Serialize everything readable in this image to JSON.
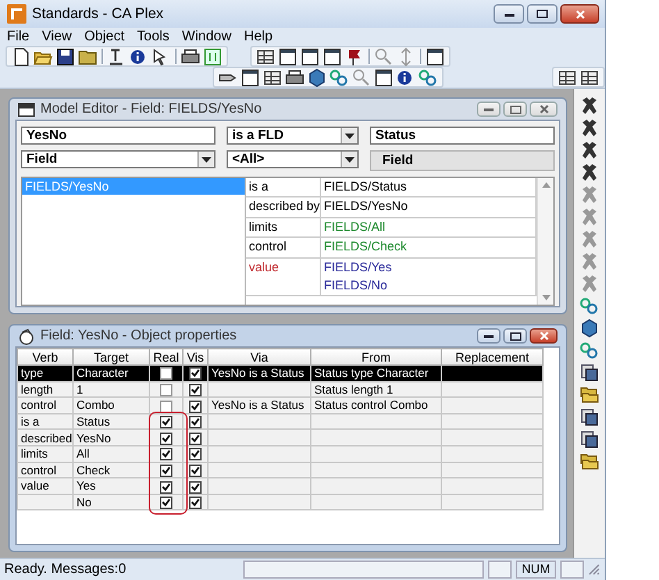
{
  "window": {
    "title": "Standards - CA Plex"
  },
  "menu": [
    "File",
    "View",
    "Object",
    "Tools",
    "Window",
    "Help"
  ],
  "model_editor": {
    "title": "Model Editor - Field: FIELDS/YesNo",
    "filters": [
      {
        "kind": "text",
        "value": "YesNo"
      },
      {
        "kind": "dropdown",
        "value": "is a FLD"
      },
      {
        "kind": "text",
        "value": "Status"
      },
      {
        "kind": "dropdown",
        "value": "Field"
      },
      {
        "kind": "dropdown",
        "value": "<All>"
      },
      {
        "kind": "label",
        "value": "Field"
      }
    ],
    "objects": [
      {
        "text": "FIELDS/YesNo",
        "selected": true
      }
    ],
    "relations": [
      {
        "verb": {
          "text": "is a",
          "color": "#000000"
        },
        "target": "FIELDS/Status",
        "color": "#000000"
      },
      {
        "verb": {
          "text": "described by",
          "color": "#000000"
        },
        "target": "FIELDS/YesNo",
        "color": "#000000"
      },
      {
        "verb": {
          "text": "limits",
          "color": "#000000"
        },
        "target": "FIELDS/All",
        "color": "#1e8a2e"
      },
      {
        "verb": {
          "text": "control",
          "color": "#000000"
        },
        "target": "FIELDS/Check",
        "color": "#1e8a2e"
      },
      {
        "verb": {
          "text": "value",
          "color": "#c0282d"
        },
        "target": "FIELDS/Yes",
        "color": "#2a2a9a"
      },
      {
        "target": "FIELDS/No",
        "color": "#2a2a9a"
      }
    ]
  },
  "properties": {
    "title": "Field: YesNo - Object properties",
    "columns": [
      "Verb",
      "Target",
      "Real",
      "Vis",
      "Via",
      "From",
      "Replacement"
    ],
    "real_checks_outlined": true,
    "rows": [
      {
        "verb": "type",
        "target": "Character",
        "real": false,
        "vis": true,
        "via": "YesNo is a Status",
        "from": "Status type Character",
        "selected": true
      },
      {
        "verb": "length",
        "target": "1",
        "real": false,
        "vis": true,
        "from": "Status length 1",
        "selected": false
      },
      {
        "verb": "control",
        "target": "Combo",
        "real": false,
        "vis": true,
        "via": "YesNo is a Status",
        "from": "Status control Combo",
        "selected": false
      },
      {
        "verb": "is a",
        "target": "Status",
        "real": true,
        "vis": true,
        "selected": false
      },
      {
        "verb": "described",
        "target": "YesNo",
        "real": true,
        "vis": true,
        "selected": false
      },
      {
        "verb": "limits",
        "target": "All",
        "real": true,
        "vis": true,
        "selected": false
      },
      {
        "verb": "control",
        "target": "Check",
        "real": true,
        "vis": true,
        "selected": false
      },
      {
        "verb": "value",
        "target": "Yes",
        "real": true,
        "vis": true,
        "selected": false
      },
      {
        "target": "No",
        "real": true,
        "vis": true,
        "selected": false
      }
    ]
  },
  "status_bar": {
    "message": "Ready. Messages:0",
    "indicator": "NUM"
  }
}
